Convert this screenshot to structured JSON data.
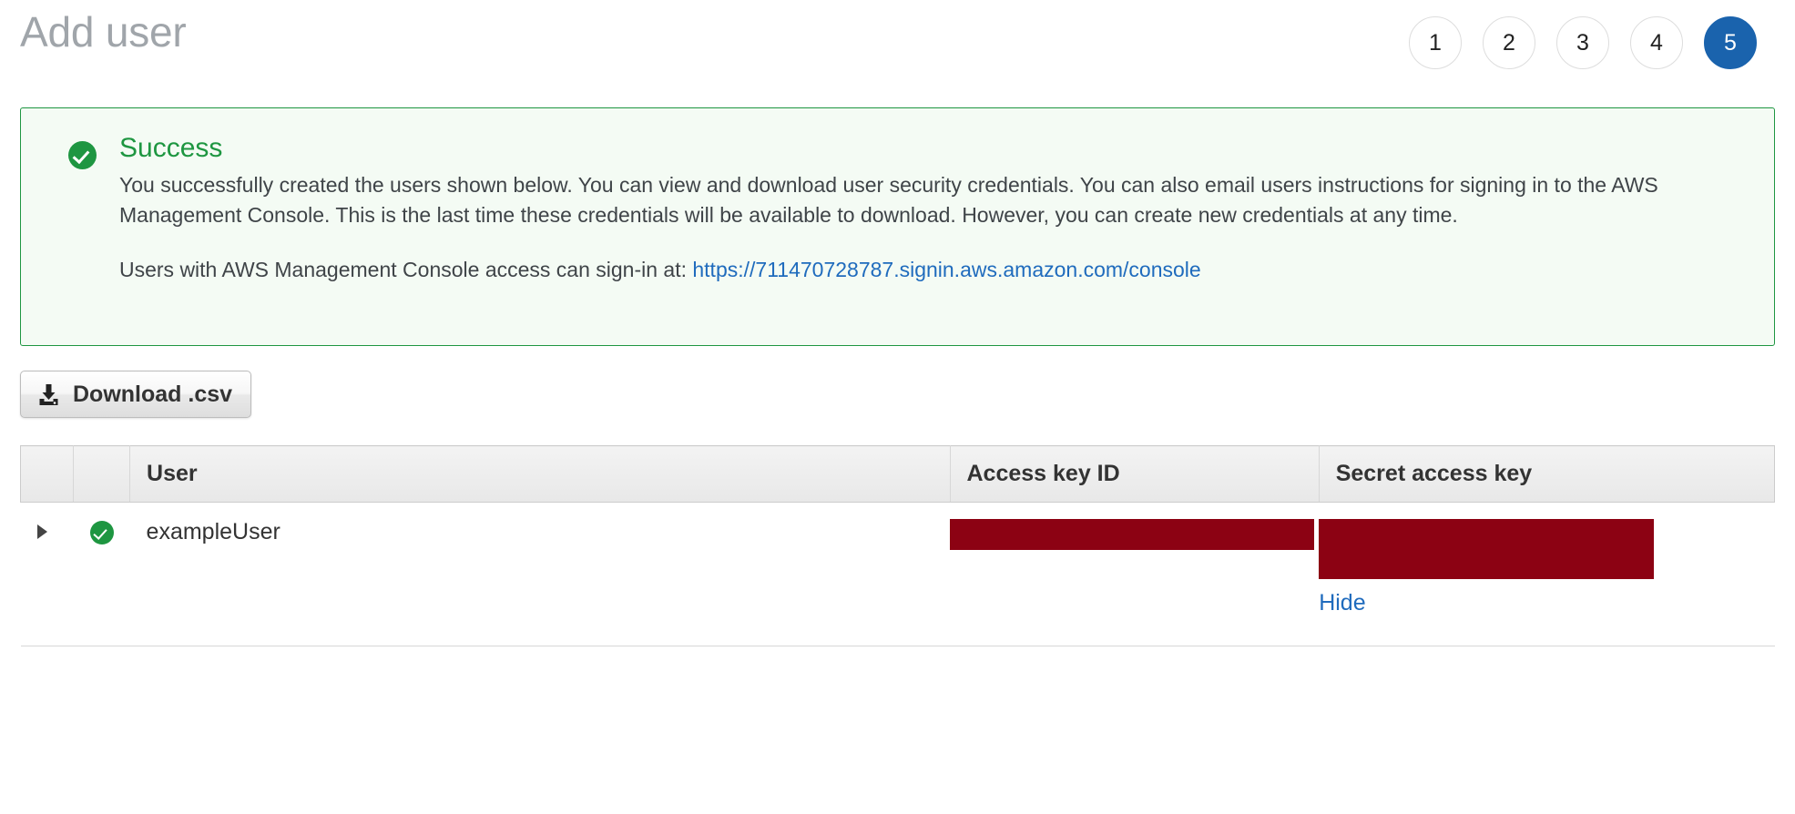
{
  "header": {
    "title": "Add user",
    "steps": [
      {
        "label": "1",
        "active": false
      },
      {
        "label": "2",
        "active": false
      },
      {
        "label": "3",
        "active": false
      },
      {
        "label": "4",
        "active": false
      },
      {
        "label": "5",
        "active": true
      }
    ]
  },
  "alert": {
    "type": "success",
    "icon": "check-circle-icon",
    "title": "Success",
    "paragraph": "You successfully created the users shown below. You can view and download user security credentials. You can also email users instructions for signing in to the AWS Management Console. This is the last time these credentials will be available to download. However, you can create new credentials at any time.",
    "signin_prefix": "Users with AWS Management Console access can sign-in at:",
    "signin_url": "https://711470728787.signin.aws.amazon.com/console",
    "border_color": "#1e9641",
    "background_color": "#f4fbf4",
    "title_color": "#1e9641",
    "link_color": "#1f6bbd"
  },
  "toolbar": {
    "download_label": "Download .csv",
    "download_icon": "download-icon"
  },
  "table": {
    "columns": [
      "",
      "",
      "User",
      "Access key ID",
      "Secret access key"
    ],
    "rows": [
      {
        "expand_icon": "caret-right-icon",
        "status_icon": "check-circle-icon",
        "user": "exampleUser",
        "access_key_id": "",
        "access_key_id_redacted": true,
        "secret_access_key": "",
        "secret_access_key_redacted": true,
        "secret_toggle_label": "Hide"
      }
    ],
    "redaction_color": "#8c0213"
  }
}
